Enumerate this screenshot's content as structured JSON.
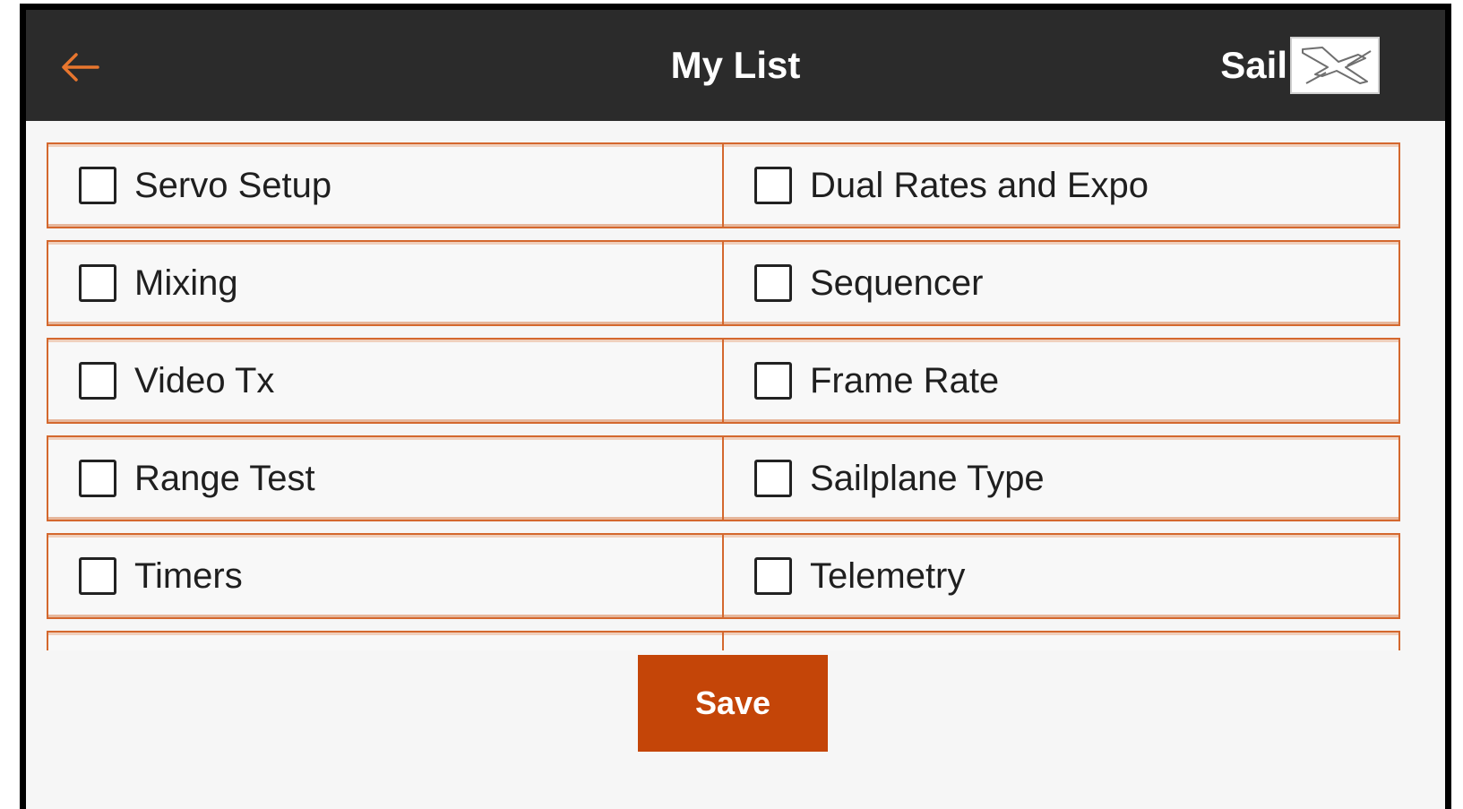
{
  "header": {
    "title": "My List",
    "model_name": "Sail",
    "back_icon": "arrow-left-icon",
    "model_icon": "sailplane-icon"
  },
  "colors": {
    "accent": "#e8762e",
    "header_bg": "#2b2b2b",
    "item_border": "#d4682e",
    "save_button": "#c44508"
  },
  "items": [
    {
      "label": "Servo Setup",
      "checked": false
    },
    {
      "label": "Dual Rates and Expo",
      "checked": false
    },
    {
      "label": "Mixing",
      "checked": false
    },
    {
      "label": "Sequencer",
      "checked": false
    },
    {
      "label": "Video Tx",
      "checked": false
    },
    {
      "label": "Frame Rate",
      "checked": false
    },
    {
      "label": "Range Test",
      "checked": false
    },
    {
      "label": "Sailplane Type",
      "checked": false
    },
    {
      "label": "Timers",
      "checked": false
    },
    {
      "label": "Telemetry",
      "checked": false
    },
    {
      "label": "",
      "checked": false
    },
    {
      "label": "",
      "checked": false
    }
  ],
  "actions": {
    "save_label": "Save"
  }
}
